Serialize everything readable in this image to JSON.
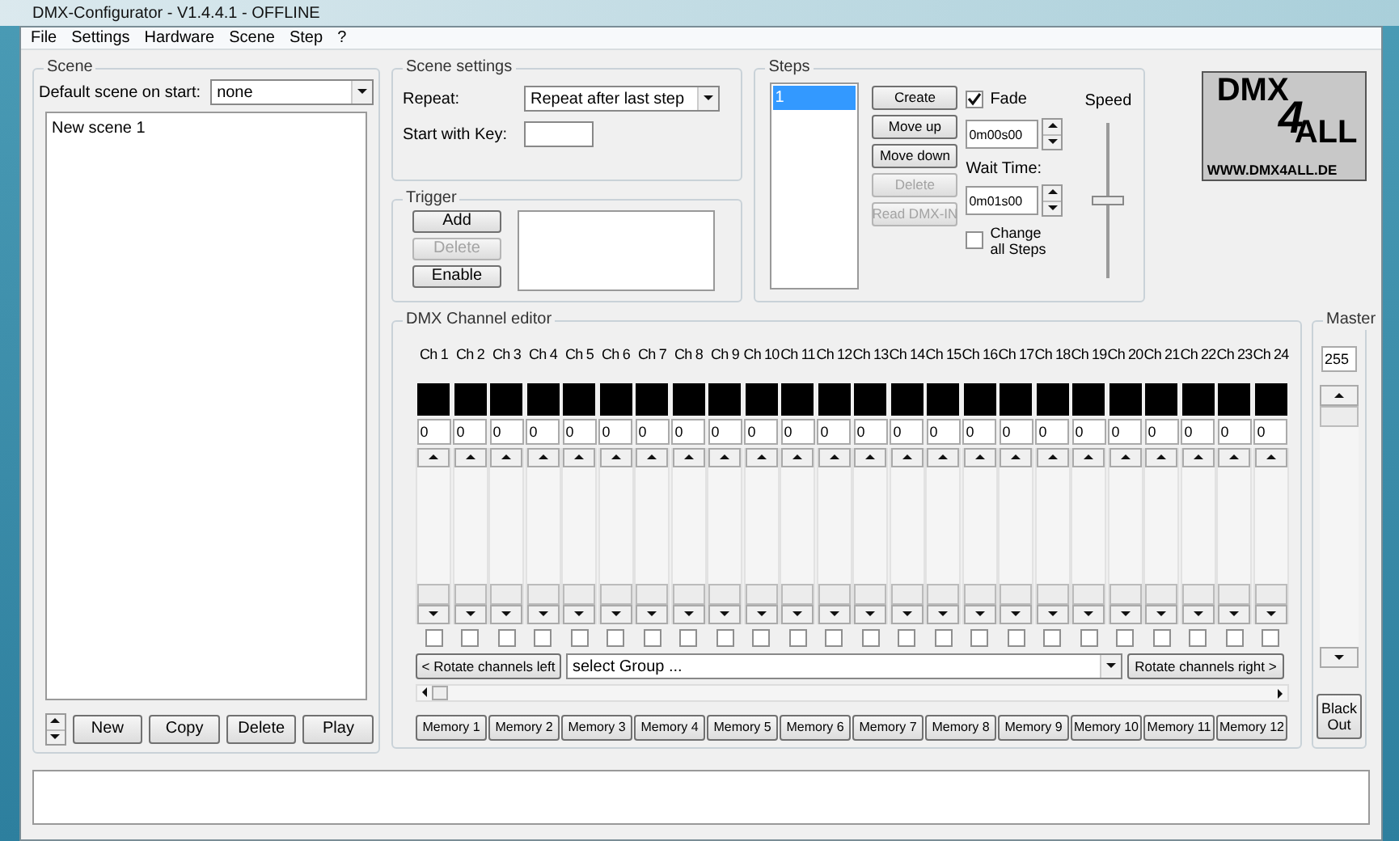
{
  "window": {
    "title": "DMX-Configurator - V1.4.4.1 - OFFLINE"
  },
  "menu": [
    "File",
    "Settings",
    "Hardware",
    "Scene",
    "Step",
    "?"
  ],
  "scene": {
    "title": "Scene",
    "default_label": "Default scene on start:",
    "default_value": "none",
    "items": [
      {
        "label": "New scene 1",
        "selected": false
      }
    ],
    "buttons": [
      {
        "label": "New",
        "disabled": false
      },
      {
        "label": "Copy",
        "disabled": false
      },
      {
        "label": "Delete",
        "disabled": false
      },
      {
        "label": "Play",
        "disabled": false
      }
    ]
  },
  "scene_settings": {
    "title": "Scene settings",
    "repeat_label": "Repeat:",
    "repeat_value": "Repeat after last step",
    "key_label": "Start with Key:"
  },
  "trigger": {
    "title": "Trigger",
    "buttons": [
      {
        "label": "Add",
        "disabled": false
      },
      {
        "label": "Delete",
        "disabled": true
      },
      {
        "label": "Enable",
        "disabled": false
      }
    ]
  },
  "steps": {
    "title": "Steps",
    "items": [
      {
        "label": "1",
        "selected": true
      }
    ],
    "buttons": [
      {
        "label": "Create",
        "disabled": false
      },
      {
        "label": "Move up",
        "disabled": false
      },
      {
        "label": "Move down",
        "disabled": false
      },
      {
        "label": "Delete",
        "disabled": true
      },
      {
        "label": "Read DMX-IN",
        "disabled": true
      }
    ],
    "fade": {
      "label": "Fade",
      "checked": true
    },
    "fade_time": "0m00s00",
    "wait_label": "Wait Time:",
    "wait_time": "0m01s00",
    "change_all": {
      "label": "Change all Steps",
      "checked": false
    },
    "speed_label": "Speed",
    "speed": {
      "level": 0.5
    }
  },
  "logo": {
    "top": "DMX",
    "mid": "4",
    "right": "ALL",
    "url": "WWW.DMX4ALL.DE"
  },
  "channel_editor": {
    "title": "DMX Channel editor",
    "channels": [
      {
        "label": "Ch 1",
        "value": "0",
        "checked": false
      },
      {
        "label": "Ch 2",
        "value": "0",
        "checked": false
      },
      {
        "label": "Ch 3",
        "value": "0",
        "checked": false
      },
      {
        "label": "Ch 4",
        "value": "0",
        "checked": false
      },
      {
        "label": "Ch 5",
        "value": "0",
        "checked": false
      },
      {
        "label": "Ch 6",
        "value": "0",
        "checked": false
      },
      {
        "label": "Ch 7",
        "value": "0",
        "checked": false
      },
      {
        "label": "Ch 8",
        "value": "0",
        "checked": false
      },
      {
        "label": "Ch 9",
        "value": "0",
        "checked": false
      },
      {
        "label": "Ch 10",
        "value": "0",
        "checked": false
      },
      {
        "label": "Ch 11",
        "value": "0",
        "checked": false
      },
      {
        "label": "Ch 12",
        "value": "0",
        "checked": false
      },
      {
        "label": "Ch 13",
        "value": "0",
        "checked": false
      },
      {
        "label": "Ch 14",
        "value": "0",
        "checked": false
      },
      {
        "label": "Ch 15",
        "value": "0",
        "checked": false
      },
      {
        "label": "Ch 16",
        "value": "0",
        "checked": false
      },
      {
        "label": "Ch 17",
        "value": "0",
        "checked": false
      },
      {
        "label": "Ch 18",
        "value": "0",
        "checked": false
      },
      {
        "label": "Ch 19",
        "value": "0",
        "checked": false
      },
      {
        "label": "Ch 20",
        "value": "0",
        "checked": false
      },
      {
        "label": "Ch 21",
        "value": "0",
        "checked": false
      },
      {
        "label": "Ch 22",
        "value": "0",
        "checked": false
      },
      {
        "label": "Ch 23",
        "value": "0",
        "checked": false
      },
      {
        "label": "Ch 24",
        "value": "0",
        "checked": false
      }
    ],
    "rotate_left": "< Rotate channels left",
    "group_value": "select Group ...",
    "rotate_right": "Rotate channels right >",
    "memories": [
      "Memory 1",
      "Memory 2",
      "Memory 3",
      "Memory 4",
      "Memory 5",
      "Memory 6",
      "Memory 7",
      "Memory 8",
      "Memory 9",
      "Memory 10",
      "Memory 11",
      "Memory 12"
    ]
  },
  "master": {
    "title": "Master",
    "value": "255",
    "blackout": "Black Out"
  }
}
